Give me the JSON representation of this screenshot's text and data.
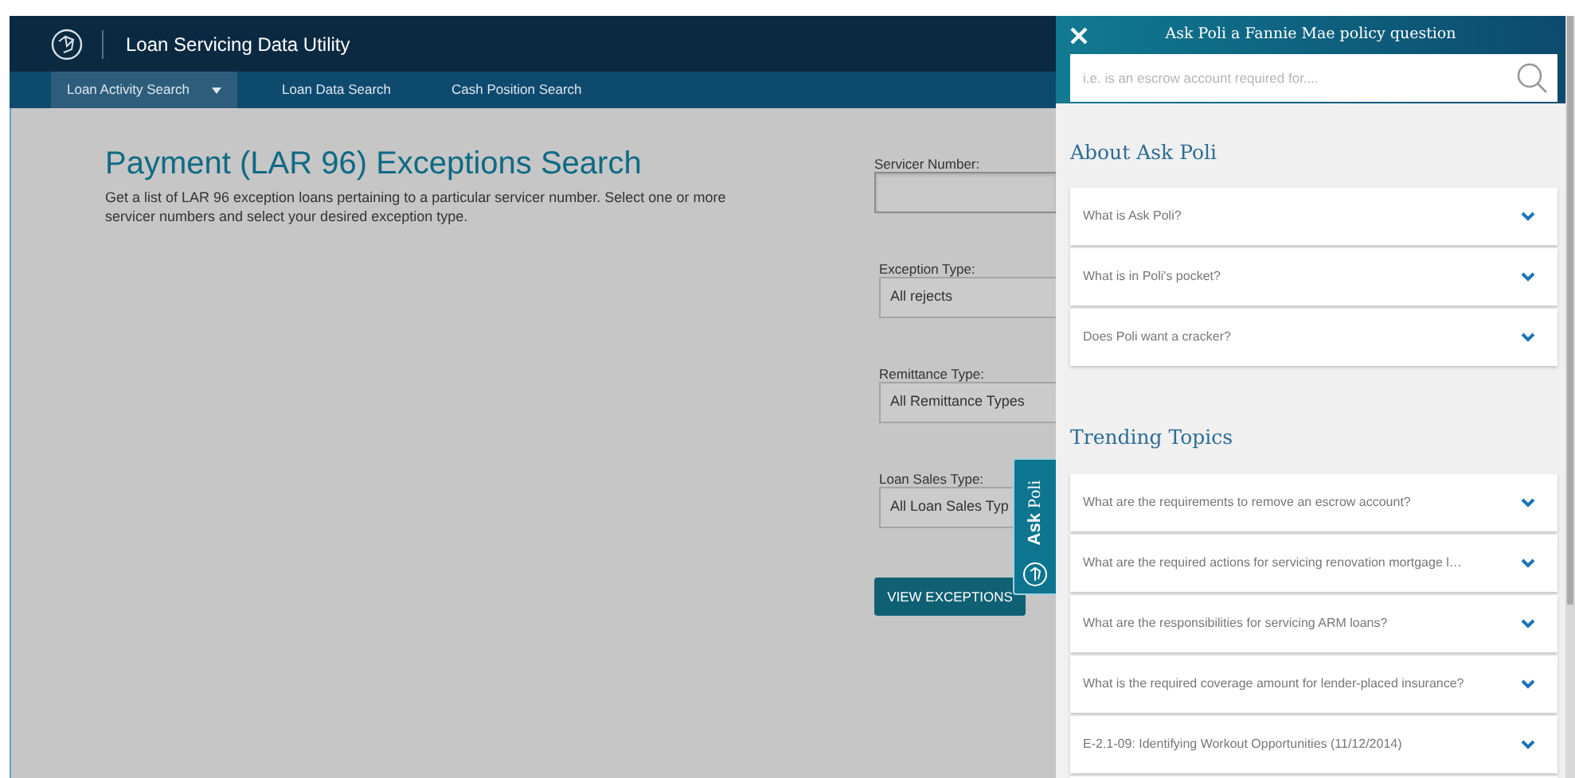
{
  "app": {
    "title": "Loan Servicing Data Utility"
  },
  "nav": [
    {
      "label": "Loan Activity Search",
      "selected": true,
      "dropdown": true
    },
    {
      "label": "Loan Data Search",
      "selected": false,
      "dropdown": false
    },
    {
      "label": "Cash Position Search",
      "selected": false,
      "dropdown": false
    }
  ],
  "page": {
    "title": "Payment (LAR 96) Exceptions Search",
    "description": "Get a list of LAR 96 exception loans pertaining to a particular servicer number. Select one or more servicer numbers and select your desired exception type."
  },
  "form": {
    "fields": [
      {
        "label": "Servicer Number:",
        "kind": "input"
      },
      {
        "label": "Exception Type:",
        "kind": "select",
        "value": "All rejects"
      },
      {
        "label": "Remittance Type:",
        "kind": "select",
        "value": "All Remittance Types"
      },
      {
        "label": "Loan Sales Type:",
        "kind": "select",
        "value": "All Loan Sales Typ"
      }
    ],
    "button": "VIEW EXCEPTIONS"
  },
  "ask_tab": {
    "label_bold": "Ask",
    "label": "Poli"
  },
  "panel": {
    "title": "Ask Poli a Fannie Mae policy question",
    "search_placeholder": "i.e. is an escrow account required for....",
    "sections": [
      {
        "title": "About Ask Poli",
        "items": [
          "What is Ask Poli?",
          "What is in Poli's pocket?",
          "Does Poli want a cracker?"
        ]
      },
      {
        "title": "Trending Topics",
        "items": [
          "What are the requirements to remove an escrow account?",
          "What are the required actions for servicing renovation mortgage l…",
          "What are the responsibilities for servicing ARM loans?",
          "What is the required coverage amount for lender-placed insurance?",
          "E-2.1-09: Identifying Workout Opportunities (11/12/2014)"
        ]
      }
    ]
  }
}
